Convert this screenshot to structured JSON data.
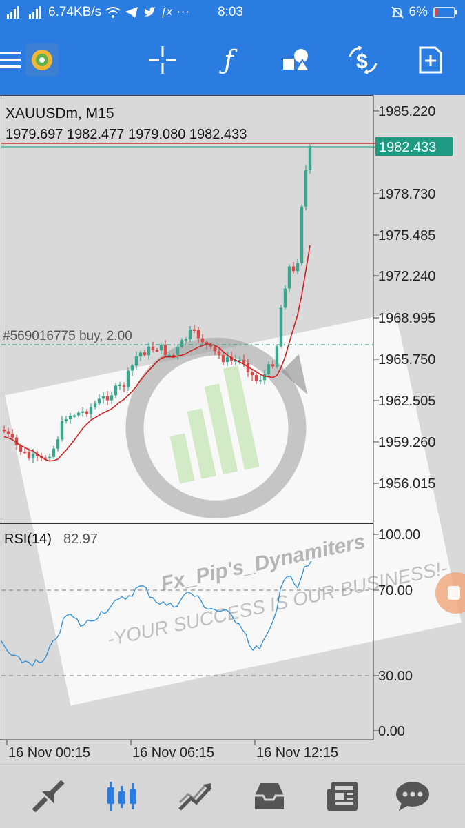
{
  "status_bar": {
    "net_speed": "6.74KB/s",
    "time": "8:03",
    "battery": "6%"
  },
  "toolbar": {
    "icons": [
      "menu-icon",
      "app-logo",
      "crosshair-icon",
      "indicator-icon",
      "objects-icon",
      "trade-icon",
      "new-chart-icon"
    ]
  },
  "chart": {
    "symbol_title": "XAUUSDm, M15",
    "ohlc": "1979.697 1982.477 1979.080 1982.433",
    "current_price": "1982.433",
    "price_ticks": [
      "1985.220",
      "1978.730",
      "1975.485",
      "1972.240",
      "1968.995",
      "1965.750",
      "1962.505",
      "1959.260",
      "1956.015"
    ],
    "order_line_label": "#569016775 buy, 2.00",
    "rsi_label": "RSI(14)",
    "rsi_value": "82.97",
    "rsi_ticks": [
      "100.00",
      "70.00",
      "30.00",
      "0.00"
    ],
    "time_labels": [
      "16 Nov 00:15",
      "16 Nov 06:15",
      "16 Nov 12:15"
    ],
    "colors": {
      "bull": "#3aa68e",
      "bear": "#d84a4a",
      "ma": "#cc2020",
      "rsi": "#2b8bd8",
      "price_tag": "#1e9a82"
    }
  },
  "watermark": {
    "title": "Fx_Pip's_Dynamiters",
    "slogan": "-YOUR SUCCESS IS OUR BUSINESS!-"
  },
  "bottom_nav": {
    "items": [
      "quotes-icon",
      "chart-icon",
      "trade-icon",
      "history-icon",
      "news-icon",
      "chat-icon"
    ],
    "active": "chart-icon"
  }
}
